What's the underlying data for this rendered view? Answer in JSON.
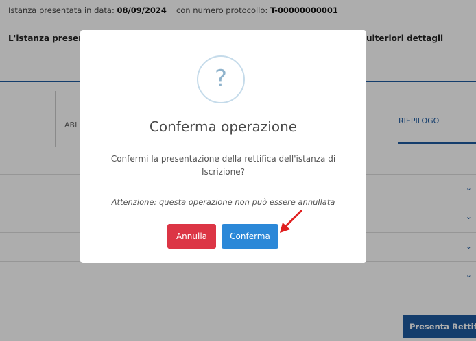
{
  "header": {
    "line_prefix": "Istanza presentata in data:",
    "date": "08/09/2024",
    "protocol_prefix": "con numero protocollo:",
    "protocol": "T-00000000001"
  },
  "status": {
    "text_start": "L'istanza presenta",
    "text_end": "ulteriori dettagli"
  },
  "tabs": {
    "partial_label": "ABI",
    "active_label": "RIEPILOGO"
  },
  "accordion": {
    "chevron": "⌄"
  },
  "footer": {
    "submit_label": "Presenta Rettifica"
  },
  "modal": {
    "icon_glyph": "?",
    "title": "Conferma operazione",
    "body": "Confermi la presentazione della rettifica dell'istanza di Iscrizione?",
    "warning": "Attenzione: questa operazione non può essere annullata",
    "cancel_label": "Annulla",
    "confirm_label": "Conferma"
  },
  "colors": {
    "primary": "#1e5aa0",
    "danger": "#dc3545",
    "confirm": "#2b88d8",
    "annotation_arrow": "#e02020"
  }
}
